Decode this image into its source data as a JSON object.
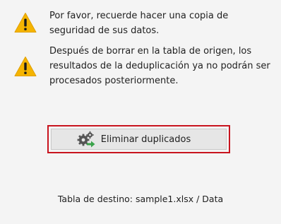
{
  "warnings": [
    {
      "icon": "warning-triangle-icon",
      "text": "Por favor, recuerde hacer una copia de\nseguridad de sus datos."
    },
    {
      "icon": "warning-triangle-icon",
      "text": "Después de borrar en la tabla de origen, los\nresultados de la deduplicación ya no podrán ser\nprocesados posteriormente."
    }
  ],
  "action": {
    "icon": "gears-arrow-icon",
    "label": "Eliminar duplicados"
  },
  "footer": {
    "destination": "Tabla de destino: sample1.xlsx / Data"
  },
  "colors": {
    "warning": "#f5b400",
    "highlight_border": "#c8141e",
    "arrow": "#3aa34a",
    "gear": "#555555"
  }
}
